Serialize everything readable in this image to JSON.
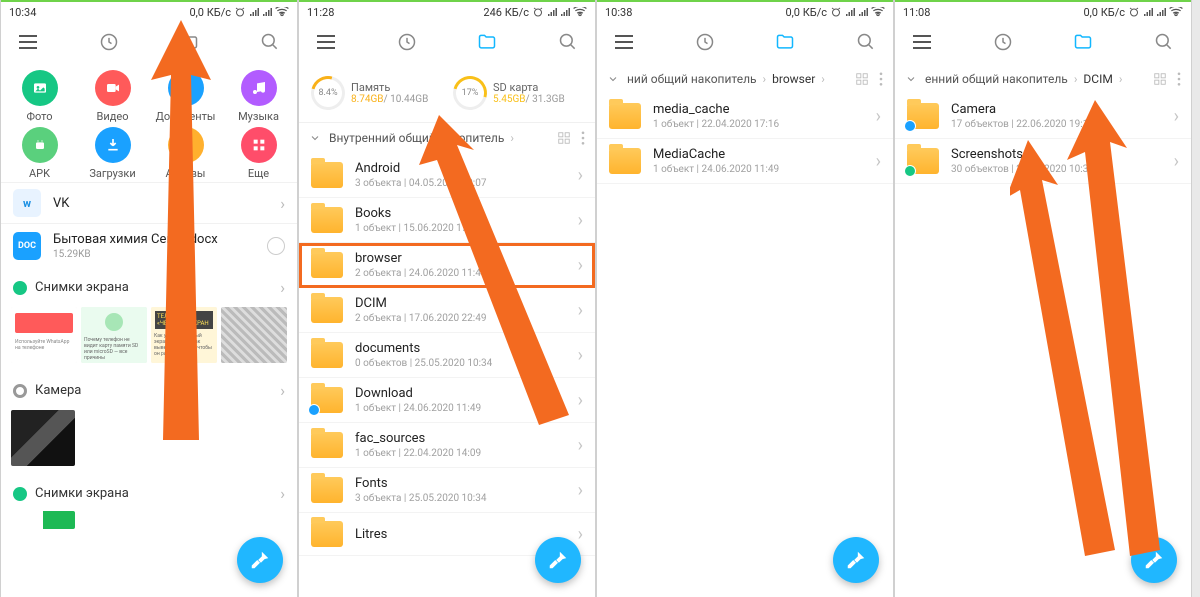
{
  "screens": [
    {
      "status": {
        "time": "10:34",
        "net": "0,0 КБ/с"
      },
      "categories": [
        {
          "label": "Фото",
          "color": "#16c784",
          "icon": "image"
        },
        {
          "label": "Видео",
          "color": "#ff5a5a",
          "icon": "video"
        },
        {
          "label": "Документы",
          "color": "#1aa1ff",
          "icon": "doc"
        },
        {
          "label": "Музыка",
          "color": "#b25cff",
          "icon": "music"
        },
        {
          "label": "APK",
          "color": "#5ad07d",
          "icon": "apk"
        },
        {
          "label": "Загрузки",
          "color": "#1aa1ff",
          "icon": "down"
        },
        {
          "label": "Архивы",
          "color": "#ffb02e",
          "icon": "zip"
        },
        {
          "label": "Еще",
          "color": "#ff4d6a",
          "icon": "grid"
        }
      ],
      "recent": [
        {
          "type": "app",
          "title": "VK",
          "color": "#1a8fe3"
        },
        {
          "type": "file",
          "title": "Бытовая химия Сем....docx",
          "sub": "15.29KB",
          "badge": "DOC",
          "badgeColor": "#1aa1ff"
        }
      ],
      "sections": [
        {
          "title": "Снимки экрана",
          "dot": "#16c784"
        },
        {
          "title": "Камера",
          "dot": "#888"
        },
        {
          "title": "Снимки экрана",
          "dot": "#16c784"
        }
      ]
    },
    {
      "status": {
        "time": "11:28",
        "net": "246 КБ/с"
      },
      "storage": [
        {
          "pct": "8.4%",
          "name": "Память",
          "used": "8.74GB",
          "total": "10.44GB",
          "ringColor": "#f9b119"
        },
        {
          "pct": "17%",
          "name": "SD карта",
          "used": "5.45GB",
          "total": "31.3GB",
          "ringColor": "#f9c019"
        }
      ],
      "breadcrumb": {
        "path": "Внутренний общий накопитель"
      },
      "folders": [
        {
          "title": "Android",
          "sub": "3 объекта  |  04.05.2020 10:07"
        },
        {
          "title": "Books",
          "sub": "1 объект  |  15.06.2020 17:12"
        },
        {
          "title": "browser",
          "sub": "2 объекта  |  24.06.2020 11:49",
          "highlight": true
        },
        {
          "title": "DCIM",
          "sub": "2 объекта  |  17.06.2020 22:49"
        },
        {
          "title": "documents",
          "sub": "0 объектов  |  25.05.2020 10:34"
        },
        {
          "title": "Download",
          "sub": "1 объект  |  24.06.2020 11:49",
          "badge": "blue"
        },
        {
          "title": "fac_sources",
          "sub": "1 объект  |  22.04.2020 14:09"
        },
        {
          "title": "Fonts",
          "sub": "3 объекта  |  25.05.2020 10:34"
        },
        {
          "title": "Litres",
          "sub": ""
        }
      ]
    },
    {
      "status": {
        "time": "10:38",
        "net": "0,0 КБ/с"
      },
      "breadcrumb": {
        "prefix": "ний общий накопитель",
        "current": "browser"
      },
      "folders": [
        {
          "title": "media_cache",
          "sub": "1 объект  |  22.04.2020 17:16"
        },
        {
          "title": "MediaCache",
          "sub": "1 объект  |  24.06.2020 11:49"
        }
      ]
    },
    {
      "status": {
        "time": "11:08",
        "net": "0,0 КБ/с"
      },
      "breadcrumb": {
        "prefix": "енний общий накопитель",
        "current": "DCIM"
      },
      "folders": [
        {
          "title": "Camera",
          "sub": "17 объектов  |  22.06.2020 19:15",
          "badge": "blue"
        },
        {
          "title": "Screenshots",
          "sub": "30 объектов  |  25.06.2020 10:38",
          "badge": "green"
        }
      ]
    }
  ]
}
